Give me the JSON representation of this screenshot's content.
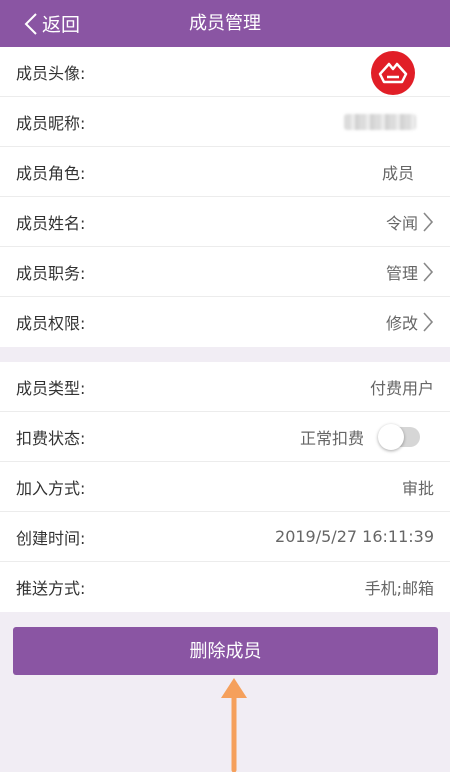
{
  "navbar": {
    "back_label": "返回",
    "title": "成员管理"
  },
  "colors": {
    "primary": "#8a55a3",
    "avatar_bg": "#e11e27",
    "arrow": "#f5a05c"
  },
  "info": {
    "avatar_label": "成员头像:",
    "nickname_label": "成员昵称:",
    "role_label": "成员角色:",
    "role_value": "成员",
    "name_label": "成员姓名:",
    "name_value": "令闻",
    "duty_label": "成员职务:",
    "duty_value": "管理",
    "permission_label": "成员权限:",
    "permission_value": "修改"
  },
  "details": {
    "type_label": "成员类型:",
    "type_value": "付费用户",
    "billing_label": "扣费状态:",
    "billing_value": "正常扣费",
    "billing_on": false,
    "join_label": "加入方式:",
    "join_value": "审批",
    "created_label": "创建时间:",
    "created_value": "2019/5/27 16:11:39",
    "push_label": "推送方式:",
    "push_value": "手机;邮箱"
  },
  "actions": {
    "delete_label": "删除成员"
  },
  "icons": [
    "back-chevron-icon",
    "chevron-right-icon",
    "avatar-logo-icon",
    "toggle-switch",
    "annotation-arrow-icon"
  ]
}
